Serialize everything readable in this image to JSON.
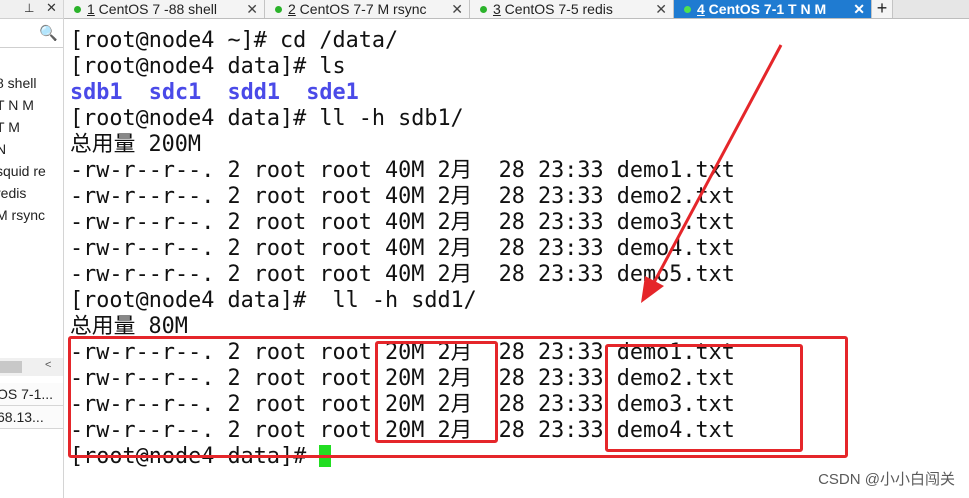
{
  "left_panel": {
    "pin_icon": "pin-icon",
    "close_icon": "close-icon",
    "search_icon": "search-icon",
    "items": [
      "8 shell",
      "T N M",
      "T M",
      "N",
      "squid re",
      "redis",
      "M rsync"
    ],
    "sessions": [
      "OS 7-1...",
      "68.13..."
    ]
  },
  "tabs": [
    {
      "number": "1",
      "title": " CentOS 7 -88 shell"
    },
    {
      "number": "2",
      "title": " CentOS 7-7 M rsync"
    },
    {
      "number": "3",
      "title": " CentOS 7-5   redis"
    },
    {
      "number": "4",
      "title": " CentOS 7-1 T N M"
    }
  ],
  "add_tab_label": "+",
  "terminal": {
    "lines": [
      "[root@node4 ~]# cd /data/",
      "[root@node4 data]# ls",
      "sdb1  sdc1  sdd1  sde1",
      "[root@node4 data]# ll -h sdb1/",
      "总用量 200M",
      "-rw-r--r--. 2 root root 40M 2月  28 23:33 demo1.txt",
      "-rw-r--r--. 2 root root 40M 2月  28 23:33 demo2.txt",
      "-rw-r--r--. 2 root root 40M 2月  28 23:33 demo3.txt",
      "-rw-r--r--. 2 root root 40M 2月  28 23:33 demo4.txt",
      "-rw-r--r--. 2 root root 40M 2月  28 23:33 demo5.txt",
      "[root@node4 data]#  ll -h sdd1/",
      "总用量 80M",
      "-rw-r--r--. 2 root root 20M 2月  28 23:33 demo1.txt",
      "-rw-r--r--. 2 root root 20M 2月  28 23:33 demo2.txt",
      "-rw-r--r--. 2 root root 20M 2月  28 23:33 demo3.txt",
      "-rw-r--r--. 2 root root 20M 2月  28 23:33 demo4.txt",
      "[root@node4 data]# "
    ],
    "cursor_color": "#22dd22",
    "dir_color": "#4a4ae8"
  },
  "annotation": {
    "color": "#e5262a"
  },
  "watermark": "CSDN @小小白闯关"
}
